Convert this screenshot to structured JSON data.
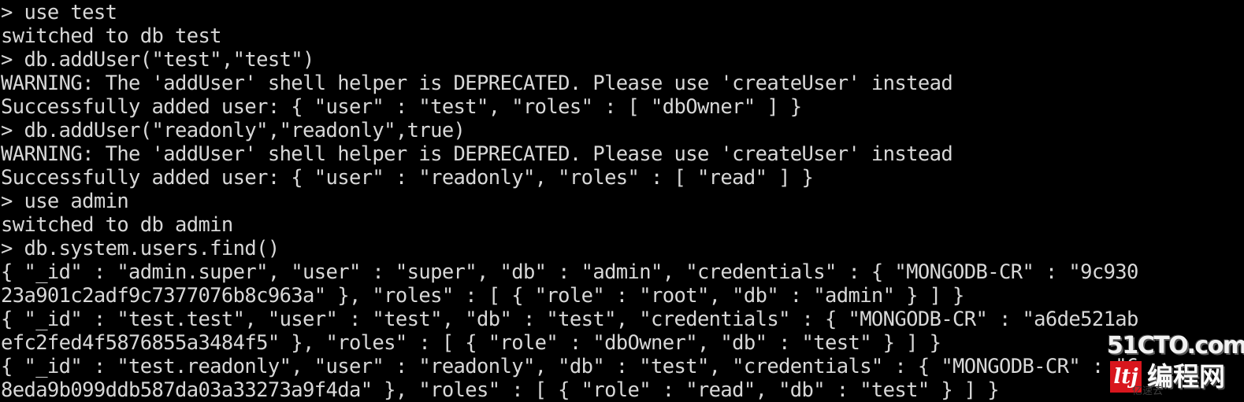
{
  "terminal": {
    "app": "mongo-shell",
    "background_color": "#000000",
    "text_color": "#d8d8d8",
    "prompt_symbol": ">",
    "lines": [
      "> use test",
      "switched to db test",
      "> db.addUser(\"test\",\"test\")",
      "WARNING: The 'addUser' shell helper is DEPRECATED. Please use 'createUser' instead",
      "Successfully added user: { \"user\" : \"test\", \"roles\" : [ \"dbOwner\" ] }",
      "> db.addUser(\"readonly\",\"readonly\",true)",
      "WARNING: The 'addUser' shell helper is DEPRECATED. Please use 'createUser' instead",
      "Successfully added user: { \"user\" : \"readonly\", \"roles\" : [ \"read\" ] }",
      "> use admin",
      "switched to db admin",
      "> db.system.users.find()",
      "{ \"_id\" : \"admin.super\", \"user\" : \"super\", \"db\" : \"admin\", \"credentials\" : { \"MONGODB-CR\" : \"9c930",
      "23a901c2adf9c7377076b8c963a\" }, \"roles\" : [ { \"role\" : \"root\", \"db\" : \"admin\" } ] }",
      "{ \"_id\" : \"test.test\", \"user\" : \"test\", \"db\" : \"test\", \"credentials\" : { \"MONGODB-CR\" : \"a6de521ab",
      "efc2fed4f5876855a3484f5\" }, \"roles\" : [ { \"role\" : \"dbOwner\", \"db\" : \"test\" } ] }",
      "{ \"_id\" : \"test.readonly\", \"user\" : \"readonly\", \"db\" : \"test\", \"credentials\" : { \"MONGODB-CR\" : \"6",
      "8eda9b099ddb587da03a33273a9f4da\" }, \"roles\" : [ { \"role\" : \"read\", \"db\" : \"test\" } ] }"
    ]
  },
  "watermark": {
    "top_text": "51CTO.com",
    "logo_text": "ltj",
    "cn_text": "编程网",
    "faint_text": "亿速云",
    "logo_color": "#d8161d"
  }
}
